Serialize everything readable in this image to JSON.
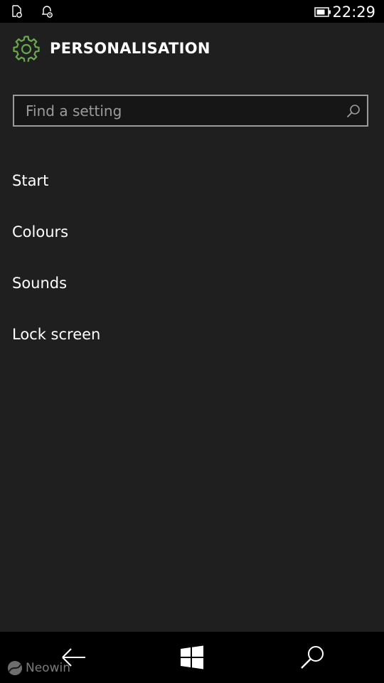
{
  "status_bar": {
    "time": "22:29",
    "icons": [
      "notification-doc-icon",
      "alarm-bell-icon",
      "battery-icon"
    ]
  },
  "header": {
    "icon": "gear-icon",
    "title": "PERSONALISATION",
    "accent_color": "#6aa84f"
  },
  "search": {
    "placeholder": "Find a setting",
    "value": "",
    "icon": "search-icon"
  },
  "settings": {
    "items": [
      {
        "label": "Start"
      },
      {
        "label": "Colours"
      },
      {
        "label": "Sounds"
      },
      {
        "label": "Lock screen"
      }
    ]
  },
  "nav_bar": {
    "buttons": [
      "back-arrow-icon",
      "windows-start-icon",
      "search-icon"
    ]
  },
  "watermark": {
    "text": "Neowin"
  }
}
